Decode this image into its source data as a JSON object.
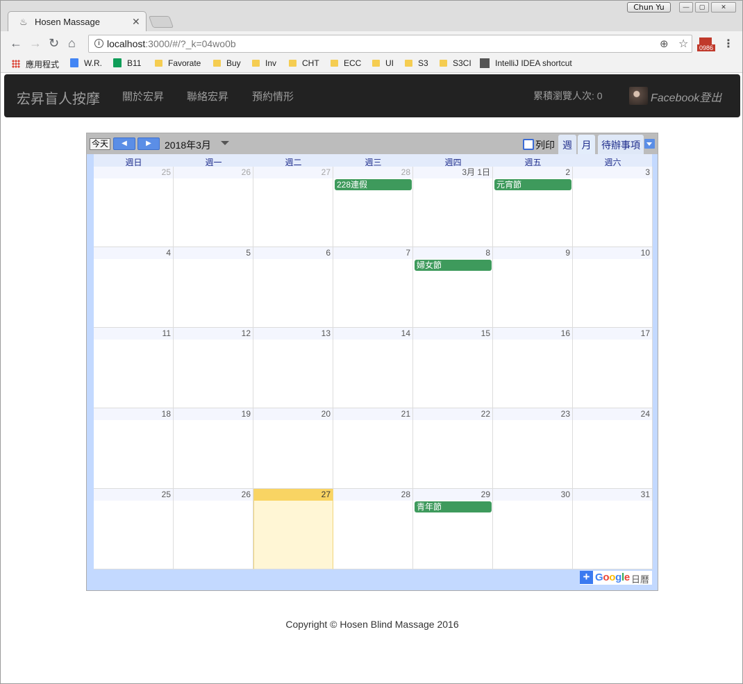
{
  "browser": {
    "user_name": "Chun Yu",
    "tab_title": "Hosen Massage",
    "url_host": "localhost",
    "url_path": ":3000/#/?_k=04wo0b",
    "extension_badge": "0986",
    "bookmarks": [
      "應用程式",
      "W.R.",
      "B11",
      "Favorate",
      "Buy",
      "Inv",
      "CHT",
      "ECC",
      "UI",
      "S3",
      "S3CI",
      "IntelliJ IDEA shortcut"
    ]
  },
  "site": {
    "brand": "宏昇盲人按摩",
    "nav": [
      "關於宏昇",
      "聯絡宏昇",
      "預約情形"
    ],
    "visits": "累積瀏覽人次: 0",
    "fb_logout": "Facebook登出"
  },
  "calendar": {
    "today_btn": "今天",
    "prev_btn": "◀",
    "next_btn": "▶",
    "current_label": "2018年3月",
    "print_label": "列印",
    "view_tabs": [
      "週",
      "月",
      "待辦事項"
    ],
    "weekdays": [
      "週日",
      "週一",
      "週二",
      "週三",
      "週四",
      "週五",
      "週六"
    ],
    "weeks": [
      [
        {
          "d": "25",
          "other": true
        },
        {
          "d": "26",
          "other": true
        },
        {
          "d": "27",
          "other": true
        },
        {
          "d": "28",
          "other": true,
          "event": "228連假"
        },
        {
          "d": "3月 1日"
        },
        {
          "d": "2",
          "event": "元宵節"
        },
        {
          "d": "3"
        }
      ],
      [
        {
          "d": "4"
        },
        {
          "d": "5"
        },
        {
          "d": "6"
        },
        {
          "d": "7"
        },
        {
          "d": "8",
          "event": "婦女節"
        },
        {
          "d": "9"
        },
        {
          "d": "10"
        }
      ],
      [
        {
          "d": "11"
        },
        {
          "d": "12"
        },
        {
          "d": "13"
        },
        {
          "d": "14"
        },
        {
          "d": "15"
        },
        {
          "d": "16"
        },
        {
          "d": "17"
        }
      ],
      [
        {
          "d": "18"
        },
        {
          "d": "19"
        },
        {
          "d": "20"
        },
        {
          "d": "21"
        },
        {
          "d": "22"
        },
        {
          "d": "23"
        },
        {
          "d": "24"
        }
      ],
      [
        {
          "d": "25"
        },
        {
          "d": "26"
        },
        {
          "d": "27",
          "today": true
        },
        {
          "d": "28"
        },
        {
          "d": "29",
          "event": "青年節"
        },
        {
          "d": "30"
        },
        {
          "d": "31"
        }
      ]
    ],
    "google_word": "Google",
    "google_sub": "日曆",
    "colors": {
      "event": "#3e9a5c",
      "today": "#f9d463",
      "header": "#c3d9ff"
    }
  },
  "footer": {
    "copyright": "Copyright © Hosen Blind Massage 2016"
  }
}
